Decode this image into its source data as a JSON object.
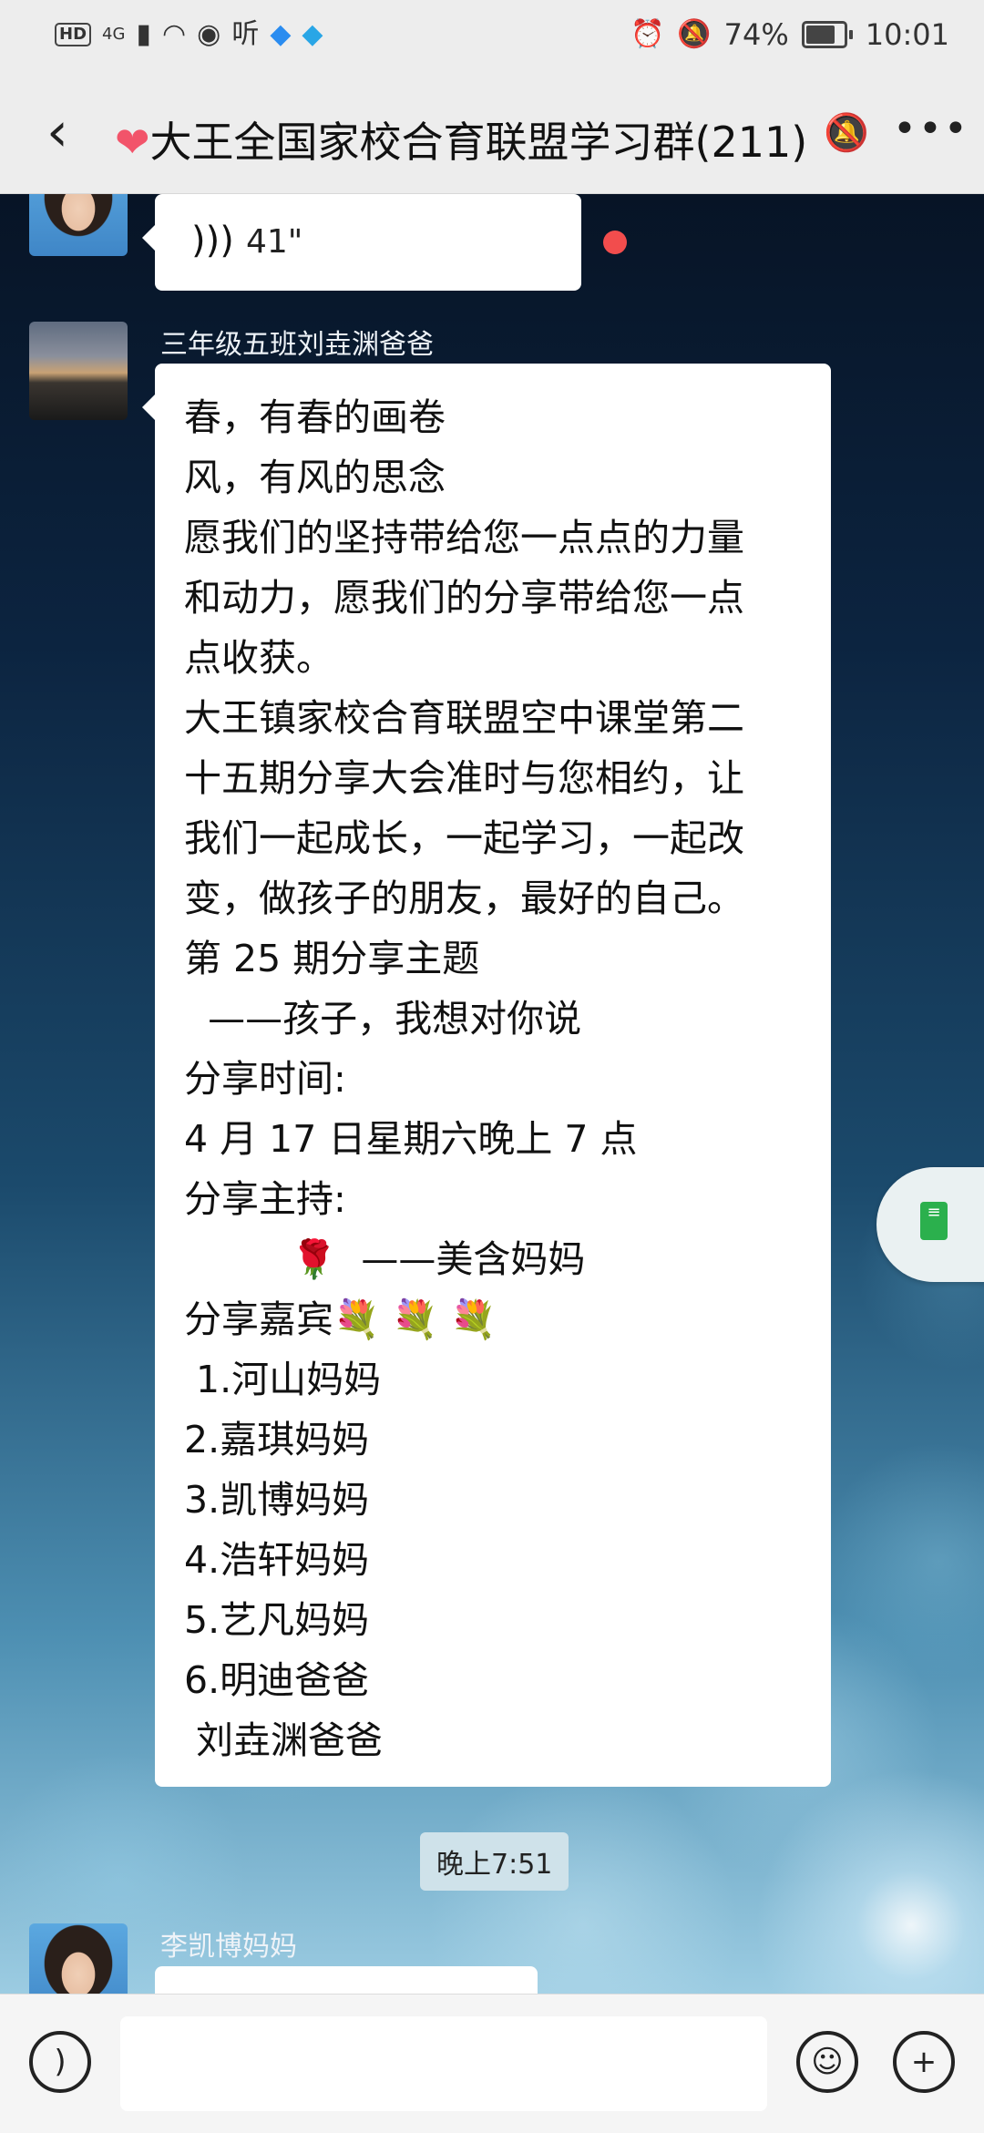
{
  "status_bar": {
    "hd": "HD",
    "network": "4G",
    "listen_label": "听",
    "battery": "74%",
    "time": "10:01"
  },
  "header": {
    "heart": "❤",
    "title": "大王全国家校合育联盟学习群(211)"
  },
  "messages": {
    "voice": {
      "duration": "41\""
    },
    "text_message": {
      "sender": "三年级五班刘垚渊爸爸",
      "lines": [
        "春，有春的画卷",
        "风，有风的思念",
        "愿我们的坚持带给您一点点的力量",
        "和动力，愿我们的分享带给您一点",
        "点收获。",
        "大王镇家校合育联盟空中课堂第二",
        "十五期分享大会准时与您相约，让",
        "我们一起成长，一起学习，一起改",
        "变，做孩子的朋友，最好的自己。",
        "第 25 期分享主题",
        "  ——孩子，我想对你说",
        "分享时间:",
        "4 月 17 日星期六晚上 7 点",
        "分享主持:",
        "         🌹  ——美含妈妈",
        "分享嘉宾💐 💐 💐",
        " 1.河山妈妈",
        "2.嘉琪妈妈",
        "3.凯博妈妈",
        "4.浩轩妈妈",
        "5.艺凡妈妈",
        "6.明迪爸爸",
        " 刘垚渊爸爸"
      ]
    },
    "timestamp": "晚上7:51",
    "next_sender": "李凯博妈妈"
  },
  "input_bar": {
    "placeholder": ""
  },
  "icons": {
    "voice": "voice-icon",
    "emoji": "emoji-icon",
    "plus": "plus-icon",
    "back": "back-arrow-icon",
    "more": "more-icon",
    "mute": "mute-bell-icon",
    "note": "note-icon"
  },
  "colors": {
    "unread_dot": "#f24d4d",
    "float_icon": "#2bb04d",
    "header_bg": "#ededed"
  }
}
